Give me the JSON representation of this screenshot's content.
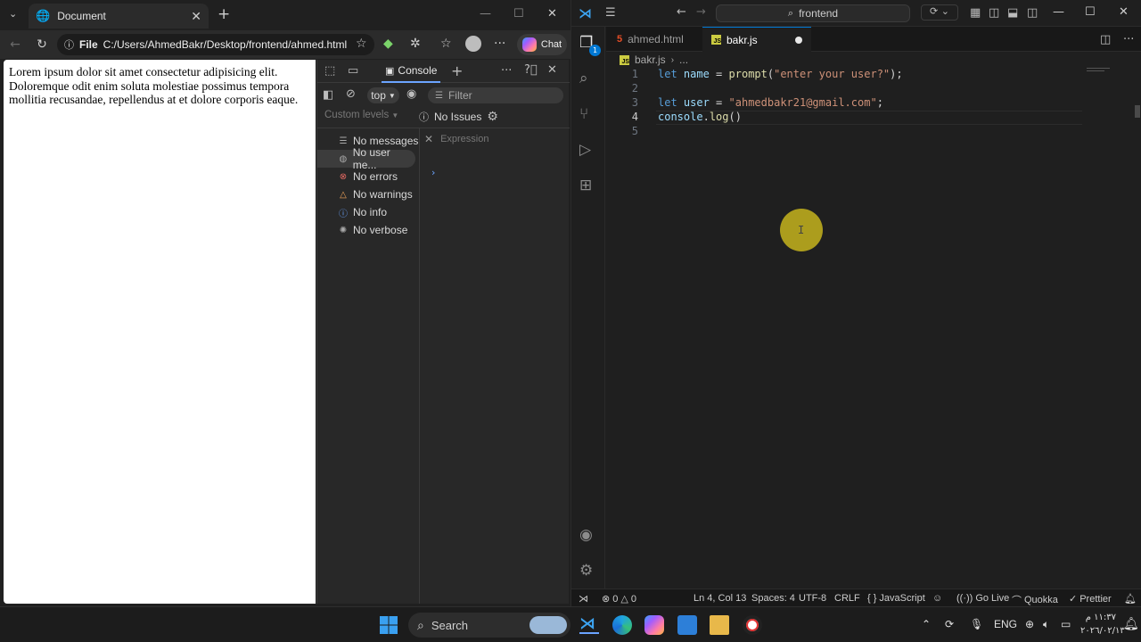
{
  "browser": {
    "tab_title": "Document",
    "address_label": "File",
    "url": "C:/Users/AhmedBakr/Desktop/frontend/ahmed.html",
    "chat_label": "Chat",
    "page_text": "Lorem ipsum dolor sit amet consectetur adipisicing elit. Doloremque odit enim soluta molestiae possimus tempora mollitia recusandae, repellendus at et dolore corporis eaque."
  },
  "devtools": {
    "console_tab": "Console",
    "context": "top",
    "filter_placeholder": "Filter",
    "levels": "Custom levels",
    "issues": "No Issues",
    "sidebar": [
      {
        "label": "No messages",
        "icon": "list-icon"
      },
      {
        "label": "No user me...",
        "icon": "user-icon"
      },
      {
        "label": "No errors",
        "icon": "error-icon"
      },
      {
        "label": "No warnings",
        "icon": "warning-icon"
      },
      {
        "label": "No info",
        "icon": "info-icon"
      },
      {
        "label": "No verbose",
        "icon": "bug-icon"
      }
    ],
    "expression_placeholder": "Expression"
  },
  "vscode": {
    "search": "frontend",
    "explorer_badge": "1",
    "tabs": [
      {
        "label": "ahmed.html"
      },
      {
        "label": "bakr.js"
      }
    ],
    "breadcrumb_file": "bakr.js",
    "breadcrumb_more": "...",
    "lines": [
      {
        "n": "1",
        "kw": "let",
        "var": "name",
        "op": " = ",
        "fn": "prompt",
        "open": "(",
        "str": "\"enter your user?\"",
        "close": ");"
      },
      {
        "n": "2"
      },
      {
        "n": "3",
        "kw": "let",
        "var": "user",
        "op": " = ",
        "str": "\"ahmedbakr21@gmail.com\"",
        "close": ";"
      },
      {
        "n": "4",
        "var": "console",
        "op": ".",
        "fn": "log",
        "close": "()"
      },
      {
        "n": "5"
      }
    ],
    "status": {
      "errors": "0",
      "warnings": "0",
      "position": "Ln 4, Col 13",
      "spaces": "Spaces: 4",
      "encoding": "UTF-8",
      "eol": "CRLF",
      "language": "JavaScript",
      "golive": "Go Live",
      "quokka": "Quokka",
      "prettier": "Prettier"
    }
  },
  "taskbar": {
    "search_label": "Search",
    "lang": "ENG",
    "time": "١١:٣٧ م",
    "date": "٢٠٢٦/٠٢/١٣"
  }
}
